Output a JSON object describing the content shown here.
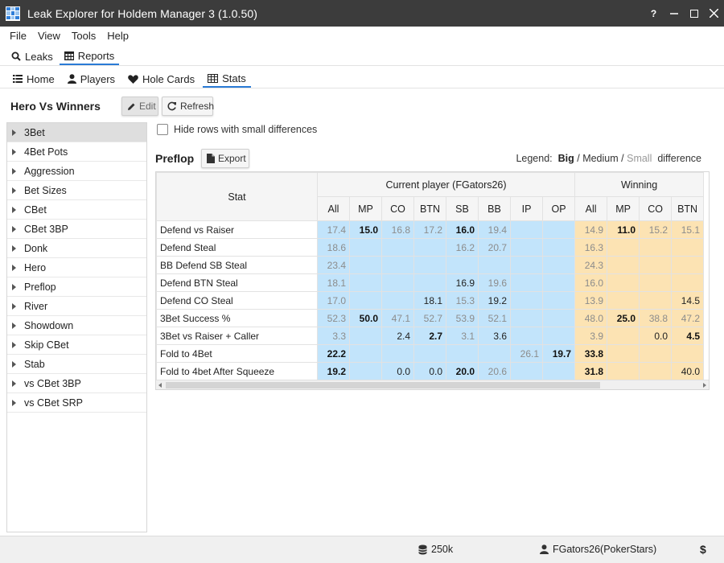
{
  "window": {
    "title": "Leak Explorer for Holdem Manager 3 (1.0.50)",
    "help_label": "?"
  },
  "menu": [
    "File",
    "View",
    "Tools",
    "Help"
  ],
  "top_tabs": [
    {
      "label": "Leaks",
      "icon": "search-icon"
    },
    {
      "label": "Reports",
      "icon": "grid-icon",
      "active": true
    }
  ],
  "sub_tabs": [
    {
      "label": "Home",
      "icon": "list-icon"
    },
    {
      "label": "Players",
      "icon": "user-icon"
    },
    {
      "label": "Hole Cards",
      "icon": "heart-icon"
    },
    {
      "label": "Stats",
      "icon": "table-icon",
      "active": true
    }
  ],
  "section": {
    "title": "Hero Vs Winners",
    "edit_label": "Edit",
    "refresh_label": "Refresh"
  },
  "sidebar": [
    "3Bet",
    "4Bet Pots",
    "Aggression",
    "Bet Sizes",
    "CBet",
    "CBet 3BP",
    "Donk",
    "Hero",
    "Preflop",
    "River",
    "Showdown",
    "Skip CBet",
    "Stab",
    "vs CBet 3BP",
    "vs CBet SRP"
  ],
  "sidebar_selected_index": 0,
  "filters": {
    "hide_small_label": "Hide rows with small differences",
    "hide_small_checked": false
  },
  "report": {
    "title": "Preflop",
    "export_label": "Export",
    "legend": {
      "prefix": "Legend:",
      "big": "Big",
      "sep1": "/",
      "medium": "Medium",
      "sep2": "/",
      "small": "Small",
      "suffix": "difference"
    }
  },
  "table": {
    "stat_header": "Stat",
    "groups": [
      {
        "label": "Current player (FGators26)",
        "columns": [
          "All",
          "MP",
          "CO",
          "BTN",
          "SB",
          "BB",
          "IP",
          "OP"
        ]
      },
      {
        "label": "Winning",
        "columns": [
          "All",
          "MP",
          "CO",
          "BTN"
        ]
      }
    ],
    "rows": [
      {
        "stat": "Defend vs Raiser",
        "current": [
          [
            "17.4",
            "small"
          ],
          [
            "15.0",
            "big"
          ],
          [
            "16.8",
            "small"
          ],
          [
            "17.2",
            "small"
          ],
          [
            "16.0",
            "big"
          ],
          [
            "19.4",
            "small"
          ],
          null,
          null
        ],
        "winning": [
          [
            "14.9",
            "small"
          ],
          [
            "11.0",
            "big"
          ],
          [
            "15.2",
            "small"
          ],
          [
            "15.1",
            "small"
          ]
        ]
      },
      {
        "stat": "Defend Steal",
        "current": [
          [
            "18.6",
            "small"
          ],
          null,
          null,
          null,
          [
            "16.2",
            "small"
          ],
          [
            "20.7",
            "small"
          ],
          null,
          null
        ],
        "winning": [
          [
            "16.3",
            "small"
          ],
          null,
          null,
          null
        ]
      },
      {
        "stat": "BB Defend SB Steal",
        "current": [
          [
            "23.4",
            "small"
          ],
          null,
          null,
          null,
          null,
          null,
          null,
          null
        ],
        "winning": [
          [
            "24.3",
            "small"
          ],
          null,
          null,
          null
        ]
      },
      {
        "stat": "Defend BTN Steal",
        "current": [
          [
            "18.1",
            "small"
          ],
          null,
          null,
          null,
          [
            "16.9",
            "medium"
          ],
          [
            "19.6",
            "small"
          ],
          null,
          null
        ],
        "winning": [
          [
            "16.0",
            "small"
          ],
          null,
          null,
          null
        ]
      },
      {
        "stat": "Defend CO Steal",
        "current": [
          [
            "17.0",
            "small"
          ],
          null,
          null,
          [
            "18.1",
            "medium"
          ],
          [
            "15.3",
            "small"
          ],
          [
            "19.2",
            "medium"
          ],
          null,
          null
        ],
        "winning": [
          [
            "13.9",
            "small"
          ],
          null,
          null,
          [
            "14.5",
            "medium"
          ]
        ]
      },
      {
        "stat": "3Bet Success %",
        "current": [
          [
            "52.3",
            "small"
          ],
          [
            "50.0",
            "big"
          ],
          [
            "47.1",
            "small"
          ],
          [
            "52.7",
            "small"
          ],
          [
            "53.9",
            "small"
          ],
          [
            "52.1",
            "small"
          ],
          null,
          null
        ],
        "winning": [
          [
            "48.0",
            "small"
          ],
          [
            "25.0",
            "big"
          ],
          [
            "38.8",
            "small"
          ],
          [
            "47.2",
            "small"
          ]
        ]
      },
      {
        "stat": "3Bet vs Raiser + Caller",
        "current": [
          [
            "3.3",
            "small"
          ],
          null,
          [
            "2.4",
            "medium"
          ],
          [
            "2.7",
            "big"
          ],
          [
            "3.1",
            "small"
          ],
          [
            "3.6",
            "medium"
          ],
          null,
          null
        ],
        "winning": [
          [
            "3.9",
            "small"
          ],
          null,
          [
            "0.0",
            "medium"
          ],
          [
            "4.5",
            "big"
          ]
        ]
      },
      {
        "stat": "Fold to 4Bet",
        "current": [
          [
            "22.2",
            "big"
          ],
          null,
          null,
          null,
          null,
          null,
          [
            "26.1",
            "small"
          ],
          [
            "19.7",
            "big"
          ]
        ],
        "winning": [
          [
            "33.8",
            "big"
          ],
          null,
          null,
          null
        ]
      },
      {
        "stat": "Fold to 4bet After Squeeze",
        "current": [
          [
            "19.2",
            "big"
          ],
          null,
          [
            "0.0",
            "medium"
          ],
          [
            "0.0",
            "medium"
          ],
          [
            "20.0",
            "big"
          ],
          [
            "20.6",
            "small"
          ],
          null,
          null
        ],
        "winning": [
          [
            "31.8",
            "big"
          ],
          null,
          null,
          [
            "40.0",
            "medium"
          ]
        ]
      }
    ]
  },
  "status": {
    "db_size": "250k",
    "player": "FGators26(PokerStars)",
    "currency": "$"
  }
}
